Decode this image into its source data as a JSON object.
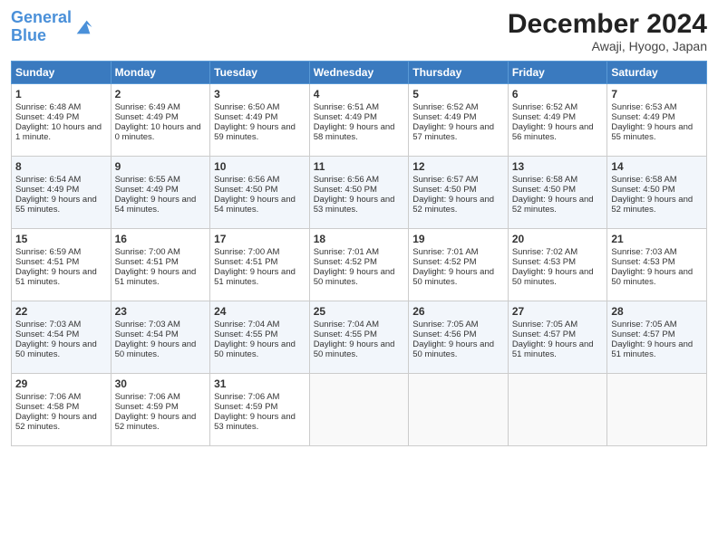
{
  "logo": {
    "line1": "General",
    "line2": "Blue"
  },
  "title": "December 2024",
  "subtitle": "Awaji, Hyogo, Japan",
  "days_of_week": [
    "Sunday",
    "Monday",
    "Tuesday",
    "Wednesday",
    "Thursday",
    "Friday",
    "Saturday"
  ],
  "weeks": [
    [
      {
        "num": "1",
        "sunrise": "Sunrise: 6:48 AM",
        "sunset": "Sunset: 4:49 PM",
        "daylight": "Daylight: 10 hours and 1 minute."
      },
      {
        "num": "2",
        "sunrise": "Sunrise: 6:49 AM",
        "sunset": "Sunset: 4:49 PM",
        "daylight": "Daylight: 10 hours and 0 minutes."
      },
      {
        "num": "3",
        "sunrise": "Sunrise: 6:50 AM",
        "sunset": "Sunset: 4:49 PM",
        "daylight": "Daylight: 9 hours and 59 minutes."
      },
      {
        "num": "4",
        "sunrise": "Sunrise: 6:51 AM",
        "sunset": "Sunset: 4:49 PM",
        "daylight": "Daylight: 9 hours and 58 minutes."
      },
      {
        "num": "5",
        "sunrise": "Sunrise: 6:52 AM",
        "sunset": "Sunset: 4:49 PM",
        "daylight": "Daylight: 9 hours and 57 minutes."
      },
      {
        "num": "6",
        "sunrise": "Sunrise: 6:52 AM",
        "sunset": "Sunset: 4:49 PM",
        "daylight": "Daylight: 9 hours and 56 minutes."
      },
      {
        "num": "7",
        "sunrise": "Sunrise: 6:53 AM",
        "sunset": "Sunset: 4:49 PM",
        "daylight": "Daylight: 9 hours and 55 minutes."
      }
    ],
    [
      {
        "num": "8",
        "sunrise": "Sunrise: 6:54 AM",
        "sunset": "Sunset: 4:49 PM",
        "daylight": "Daylight: 9 hours and 55 minutes."
      },
      {
        "num": "9",
        "sunrise": "Sunrise: 6:55 AM",
        "sunset": "Sunset: 4:49 PM",
        "daylight": "Daylight: 9 hours and 54 minutes."
      },
      {
        "num": "10",
        "sunrise": "Sunrise: 6:56 AM",
        "sunset": "Sunset: 4:50 PM",
        "daylight": "Daylight: 9 hours and 54 minutes."
      },
      {
        "num": "11",
        "sunrise": "Sunrise: 6:56 AM",
        "sunset": "Sunset: 4:50 PM",
        "daylight": "Daylight: 9 hours and 53 minutes."
      },
      {
        "num": "12",
        "sunrise": "Sunrise: 6:57 AM",
        "sunset": "Sunset: 4:50 PM",
        "daylight": "Daylight: 9 hours and 52 minutes."
      },
      {
        "num": "13",
        "sunrise": "Sunrise: 6:58 AM",
        "sunset": "Sunset: 4:50 PM",
        "daylight": "Daylight: 9 hours and 52 minutes."
      },
      {
        "num": "14",
        "sunrise": "Sunrise: 6:58 AM",
        "sunset": "Sunset: 4:50 PM",
        "daylight": "Daylight: 9 hours and 52 minutes."
      }
    ],
    [
      {
        "num": "15",
        "sunrise": "Sunrise: 6:59 AM",
        "sunset": "Sunset: 4:51 PM",
        "daylight": "Daylight: 9 hours and 51 minutes."
      },
      {
        "num": "16",
        "sunrise": "Sunrise: 7:00 AM",
        "sunset": "Sunset: 4:51 PM",
        "daylight": "Daylight: 9 hours and 51 minutes."
      },
      {
        "num": "17",
        "sunrise": "Sunrise: 7:00 AM",
        "sunset": "Sunset: 4:51 PM",
        "daylight": "Daylight: 9 hours and 51 minutes."
      },
      {
        "num": "18",
        "sunrise": "Sunrise: 7:01 AM",
        "sunset": "Sunset: 4:52 PM",
        "daylight": "Daylight: 9 hours and 50 minutes."
      },
      {
        "num": "19",
        "sunrise": "Sunrise: 7:01 AM",
        "sunset": "Sunset: 4:52 PM",
        "daylight": "Daylight: 9 hours and 50 minutes."
      },
      {
        "num": "20",
        "sunrise": "Sunrise: 7:02 AM",
        "sunset": "Sunset: 4:53 PM",
        "daylight": "Daylight: 9 hours and 50 minutes."
      },
      {
        "num": "21",
        "sunrise": "Sunrise: 7:03 AM",
        "sunset": "Sunset: 4:53 PM",
        "daylight": "Daylight: 9 hours and 50 minutes."
      }
    ],
    [
      {
        "num": "22",
        "sunrise": "Sunrise: 7:03 AM",
        "sunset": "Sunset: 4:54 PM",
        "daylight": "Daylight: 9 hours and 50 minutes."
      },
      {
        "num": "23",
        "sunrise": "Sunrise: 7:03 AM",
        "sunset": "Sunset: 4:54 PM",
        "daylight": "Daylight: 9 hours and 50 minutes."
      },
      {
        "num": "24",
        "sunrise": "Sunrise: 7:04 AM",
        "sunset": "Sunset: 4:55 PM",
        "daylight": "Daylight: 9 hours and 50 minutes."
      },
      {
        "num": "25",
        "sunrise": "Sunrise: 7:04 AM",
        "sunset": "Sunset: 4:55 PM",
        "daylight": "Daylight: 9 hours and 50 minutes."
      },
      {
        "num": "26",
        "sunrise": "Sunrise: 7:05 AM",
        "sunset": "Sunset: 4:56 PM",
        "daylight": "Daylight: 9 hours and 50 minutes."
      },
      {
        "num": "27",
        "sunrise": "Sunrise: 7:05 AM",
        "sunset": "Sunset: 4:57 PM",
        "daylight": "Daylight: 9 hours and 51 minutes."
      },
      {
        "num": "28",
        "sunrise": "Sunrise: 7:05 AM",
        "sunset": "Sunset: 4:57 PM",
        "daylight": "Daylight: 9 hours and 51 minutes."
      }
    ],
    [
      {
        "num": "29",
        "sunrise": "Sunrise: 7:06 AM",
        "sunset": "Sunset: 4:58 PM",
        "daylight": "Daylight: 9 hours and 52 minutes."
      },
      {
        "num": "30",
        "sunrise": "Sunrise: 7:06 AM",
        "sunset": "Sunset: 4:59 PM",
        "daylight": "Daylight: 9 hours and 52 minutes."
      },
      {
        "num": "31",
        "sunrise": "Sunrise: 7:06 AM",
        "sunset": "Sunset: 4:59 PM",
        "daylight": "Daylight: 9 hours and 53 minutes."
      },
      null,
      null,
      null,
      null
    ]
  ]
}
